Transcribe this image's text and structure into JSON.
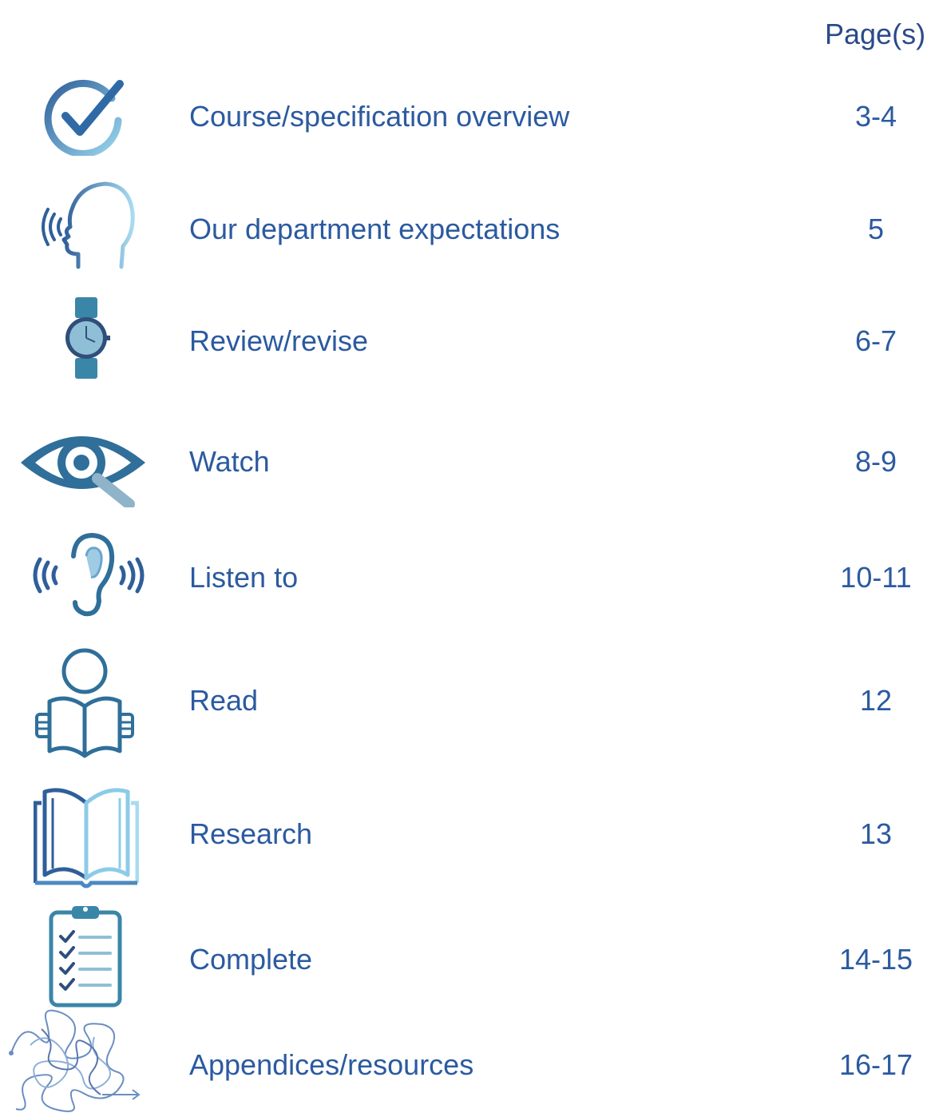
{
  "header": {
    "pages_label": "Page(s)"
  },
  "toc": [
    {
      "icon": "checkmark-circle-icon",
      "label": "Course/specification overview",
      "page": "3-4"
    },
    {
      "icon": "speaking-head-icon",
      "label": "Our department expectations",
      "page": "5"
    },
    {
      "icon": "wristwatch-icon",
      "label": "Review/revise",
      "page": "6-7"
    },
    {
      "icon": "eye-magnifier-icon",
      "label": "Watch",
      "page": "8-9"
    },
    {
      "icon": "listening-ear-icon",
      "label": "Listen to",
      "page": "10-11"
    },
    {
      "icon": "person-reading-icon",
      "label": "Read",
      "page": "12"
    },
    {
      "icon": "open-book-icon",
      "label": "Research",
      "page": "13"
    },
    {
      "icon": "clipboard-checklist-icon",
      "label": "Complete",
      "page": "14-15"
    },
    {
      "icon": "tangled-path-icon",
      "label": "Appendices/resources",
      "page": "16-17"
    }
  ],
  "colors": {
    "text": "#2b5aa0",
    "icon_dark": "#2f5f9a",
    "icon_light": "#a9dbef",
    "icon_teal": "#3a86a8"
  }
}
